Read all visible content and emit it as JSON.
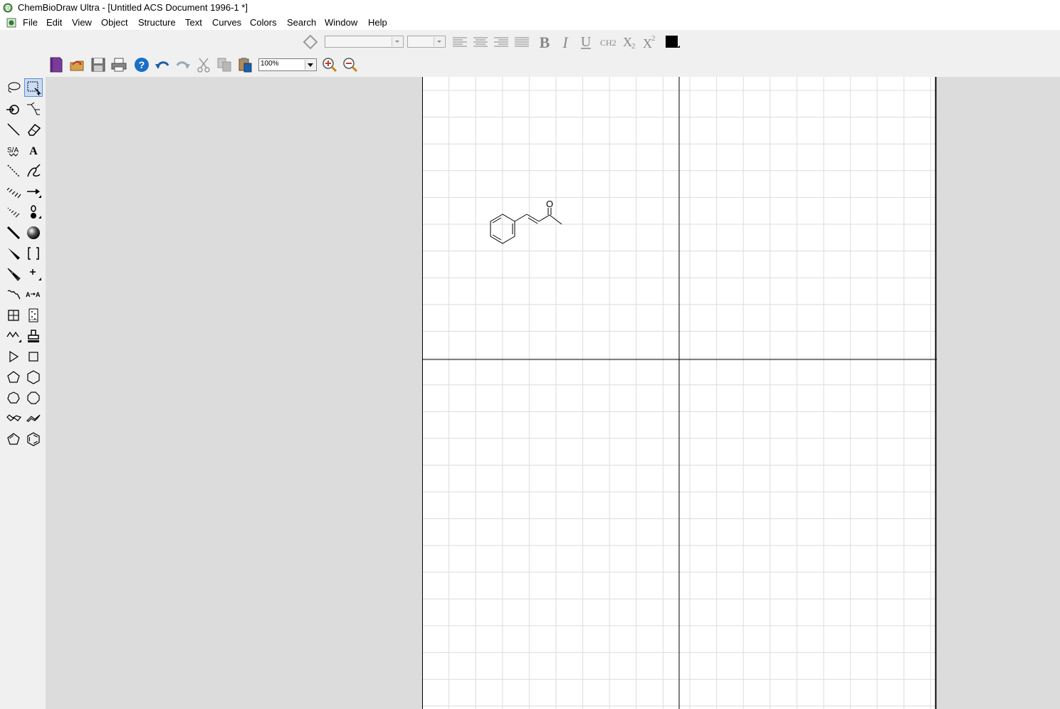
{
  "window": {
    "title": "ChemBioDraw Ultra - [Untitled ACS Document 1996-1 *]"
  },
  "menu": {
    "items": [
      "File",
      "Edit",
      "View",
      "Object",
      "Structure",
      "Text",
      "Curves",
      "Colors",
      "Search",
      "Window",
      "Help"
    ]
  },
  "format_toolbar": {
    "font_value": "",
    "size_value": "",
    "subscript_label": "CH2",
    "color": "#000000"
  },
  "main_toolbar": {
    "zoom": "100%"
  },
  "canvas": {
    "molecule": {
      "atom_label": "O"
    }
  }
}
